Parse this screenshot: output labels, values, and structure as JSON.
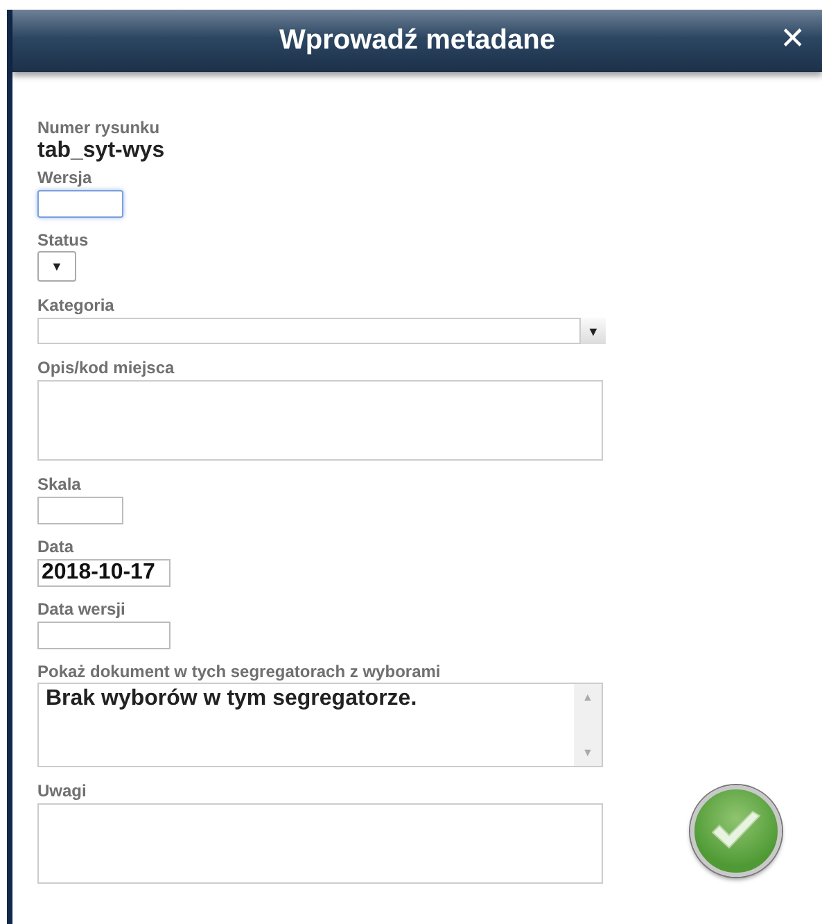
{
  "dialog": {
    "title": "Wprowadź metadane",
    "close": "✕"
  },
  "fields": [
    {
      "kind": "readonly",
      "label": "Numer rysunku",
      "value": "tab_syt-wys"
    },
    {
      "kind": "text",
      "label": "Wersja",
      "focused": true
    },
    {
      "kind": "select",
      "label": "Status",
      "caret": "▼"
    },
    {
      "kind": "combo",
      "label": "Kategoria",
      "caret": "▼"
    },
    {
      "kind": "textarea",
      "label": "Opis/kod miejsca"
    },
    {
      "kind": "text",
      "label": "Skala",
      "focused": false
    },
    {
      "kind": "date",
      "label": "Data",
      "value": "2018-10-17",
      "focused": false
    },
    {
      "kind": "date",
      "label": "Data wersji",
      "focused": false
    },
    {
      "kind": "list",
      "label": "Pokaż dokument w tych segregatorach z wyborami",
      "value": "Brak wyborów w tym segregatorze.",
      "up": "▲",
      "down": "▼"
    },
    {
      "kind": "textarea",
      "label": "Uwagi"
    }
  ]
}
